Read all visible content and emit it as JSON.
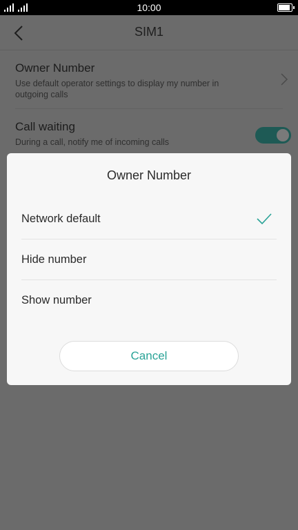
{
  "status_bar": {
    "time": "10:00"
  },
  "header": {
    "title": "SIM1",
    "back_icon": "chevron-left-icon"
  },
  "settings": [
    {
      "title": "Owner Number",
      "description": "Use default operator settings to display my number in outgoing calls",
      "control": "chevron-right-icon"
    },
    {
      "title": "Call waiting",
      "description": "During a call, notify me of incoming calls",
      "control": "toggle",
      "enabled": true
    }
  ],
  "dialog": {
    "title": "Owner Number",
    "options": [
      {
        "label": "Network default",
        "selected": true
      },
      {
        "label": "Hide number",
        "selected": false
      },
      {
        "label": "Show number",
        "selected": false
      }
    ],
    "cancel_label": "Cancel"
  },
  "colors": {
    "accent": "#2aa397",
    "overlay": "#6b6b6b",
    "dialog_bg": "#f7f7f7"
  }
}
